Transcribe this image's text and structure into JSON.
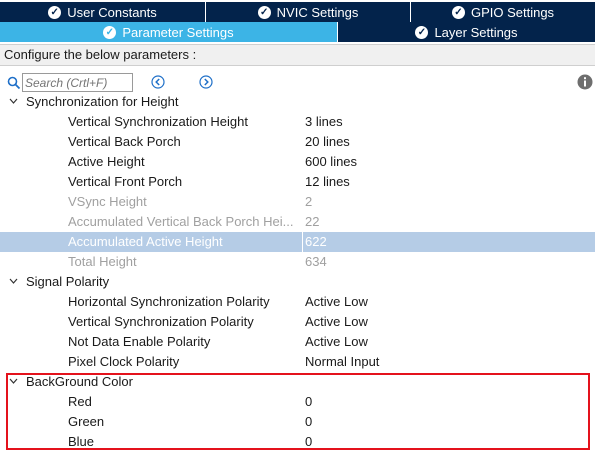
{
  "tabs_row1": [
    {
      "label": "User Constants"
    },
    {
      "label": "NVIC Settings"
    },
    {
      "label": "GPIO Settings"
    }
  ],
  "tabs_row2": [
    {
      "label": "Parameter Settings",
      "active": true
    },
    {
      "label": "Layer Settings"
    }
  ],
  "configure_text": "Configure the below parameters :",
  "search": {
    "placeholder": "Search (Crtl+F)"
  },
  "groups": [
    {
      "label": "Synchronization for Height",
      "params": [
        {
          "name": "Vertical Synchronization Height",
          "value": "3 lines"
        },
        {
          "name": "Vertical Back Porch",
          "value": "20 lines"
        },
        {
          "name": "Active Height",
          "value": "600 lines"
        },
        {
          "name": "Vertical Front Porch",
          "value": "12 lines"
        },
        {
          "name": "VSync Height",
          "value": "2"
        },
        {
          "name": "Accumulated Vertical Back Porch Hei...",
          "value": "22"
        },
        {
          "name": "Accumulated Active Height",
          "value": "622"
        },
        {
          "name": "Total Height",
          "value": "634"
        }
      ]
    },
    {
      "label": "Signal Polarity",
      "params": [
        {
          "name": "Horizontal Synchronization Polarity",
          "value": "Active Low"
        },
        {
          "name": "Vertical Synchronization Polarity",
          "value": "Active Low"
        },
        {
          "name": "Not Data Enable Polarity",
          "value": "Active Low"
        },
        {
          "name": "Pixel Clock Polarity",
          "value": "Normal Input"
        }
      ]
    },
    {
      "label": "BackGround Color",
      "params": [
        {
          "name": "Red",
          "value": "0"
        },
        {
          "name": "Green",
          "value": "0"
        },
        {
          "name": "Blue",
          "value": "0"
        }
      ]
    }
  ],
  "colors": {
    "tab_dark": "#03234b",
    "tab_active": "#3cb4e6",
    "selection": "#b5cce6",
    "highlight_border": "#e4121c"
  }
}
